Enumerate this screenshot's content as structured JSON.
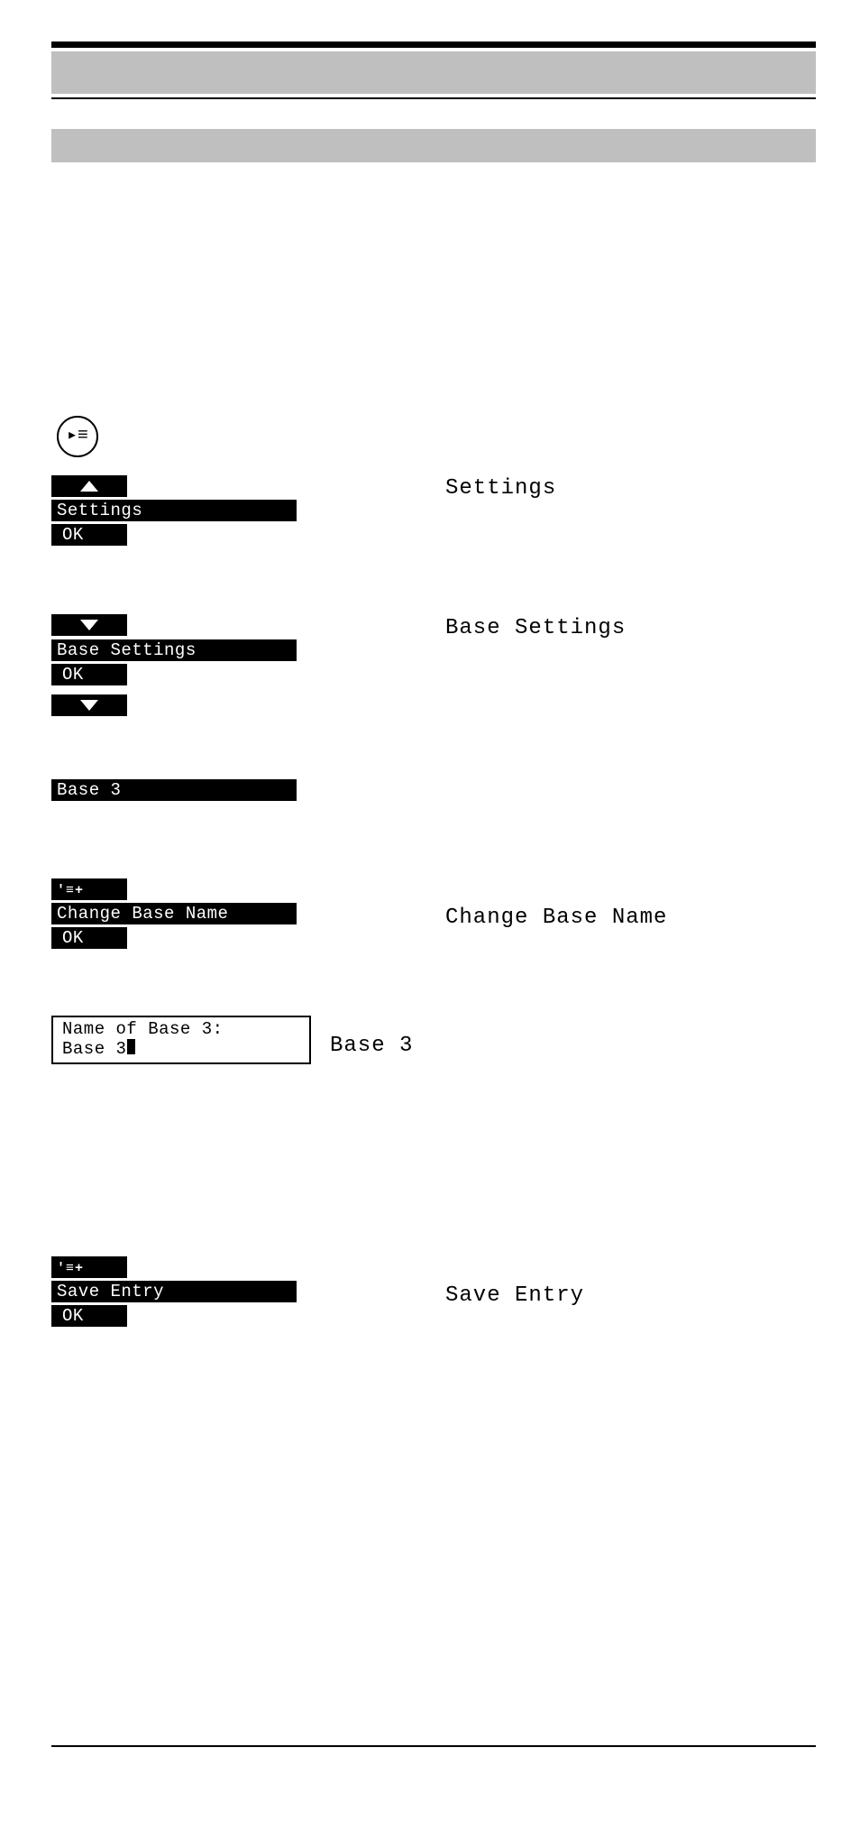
{
  "labels": {
    "ok": "OK",
    "menu_plus": "'≡+"
  },
  "steps": {
    "settings": {
      "button": "Settings",
      "caption": "Settings"
    },
    "base_settings": {
      "button": "Base Settings",
      "caption": "Base Settings"
    },
    "base3": {
      "button": "Base 3"
    },
    "change_base_name": {
      "button": "Change Base Name",
      "caption": "Change Base Name"
    },
    "name_box": {
      "line1": "Name of Base 3:",
      "value": "Base 3",
      "caption": "Base 3"
    },
    "save_entry": {
      "button": "Save Entry",
      "caption": "Save Entry"
    }
  }
}
